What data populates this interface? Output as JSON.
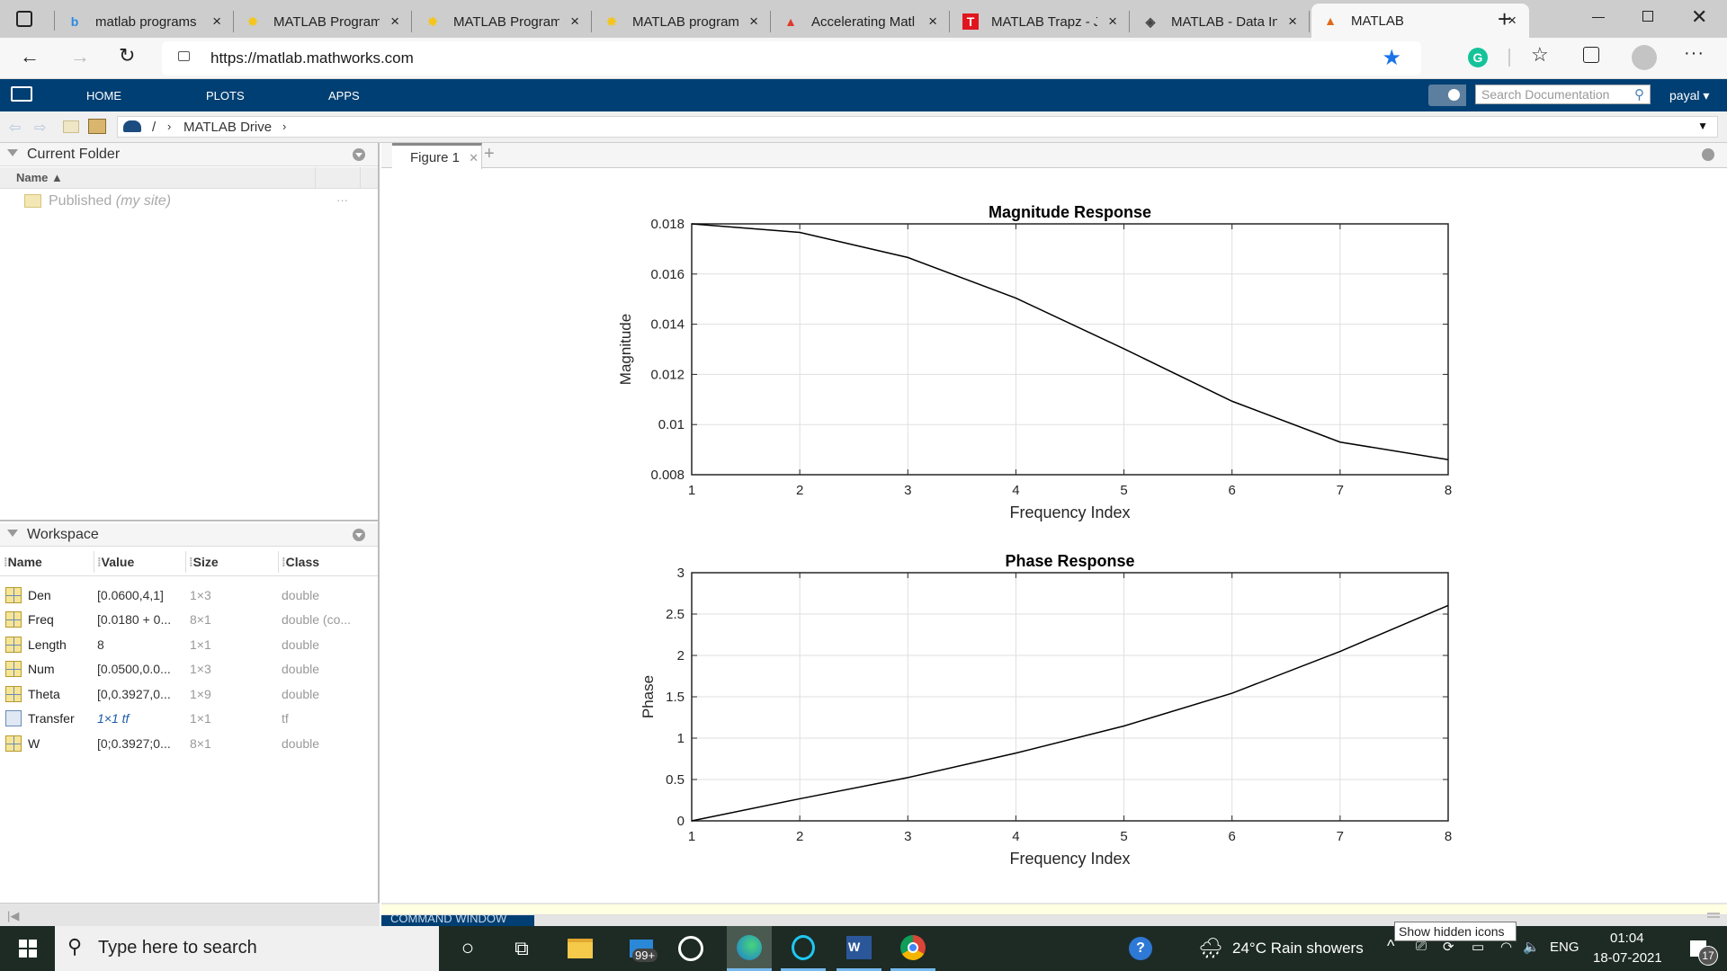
{
  "browser": {
    "tabs": [
      {
        "label": "matlab programs",
        "icon": "bing-icon",
        "active": false
      },
      {
        "label": "MATLAB Program",
        "icon": "matlab-star-icon",
        "active": false
      },
      {
        "label": "MATLAB Program",
        "icon": "matlab-star-icon",
        "active": false
      },
      {
        "label": "MATLAB program",
        "icon": "matlab-star-icon",
        "active": false
      },
      {
        "label": "Accelerating Matl",
        "icon": "mathworks-icon",
        "active": false
      },
      {
        "label": "MATLAB Trapz - J",
        "icon": "t-icon",
        "active": false
      },
      {
        "label": "MATLAB - Data In",
        "icon": "diamond-icon",
        "active": false
      },
      {
        "label": "MATLAB",
        "icon": "matlab-icon",
        "active": true
      }
    ],
    "url": "https://matlab.mathworks.com",
    "new_tab": "+",
    "close": "×"
  },
  "matlab": {
    "toolstrip_tabs": [
      "HOME",
      "PLOTS",
      "APPS"
    ],
    "search_placeholder": "Search Documentation",
    "user": "payal",
    "breadcrumb": [
      "/",
      "MATLAB Drive"
    ],
    "current_folder": {
      "title": "Current Folder",
      "column": "Name",
      "items": [
        {
          "name": "Published",
          "note": "(my site)",
          "more": "···"
        }
      ]
    },
    "workspace": {
      "title": "Workspace",
      "columns": [
        "Name",
        "Value",
        "Size",
        "Class"
      ],
      "rows": [
        {
          "name": "Den",
          "value": "[0.0600,4,1]",
          "size": "1×3",
          "class": "double",
          "type": "matrix"
        },
        {
          "name": "Freq",
          "value": "[0.0180 + 0...",
          "size": "8×1",
          "class": "double (co...",
          "type": "matrix"
        },
        {
          "name": "Length",
          "value": "8",
          "size": "1×1",
          "class": "double",
          "type": "matrix"
        },
        {
          "name": "Num",
          "value": "[0.0500,0.0...",
          "size": "1×3",
          "class": "double",
          "type": "matrix"
        },
        {
          "name": "Theta",
          "value": "[0,0.3927,0...",
          "size": "1×9",
          "class": "double",
          "type": "matrix"
        },
        {
          "name": "Transfer",
          "value": "1×1 tf",
          "size": "1×1",
          "class": "tf",
          "type": "object"
        },
        {
          "name": "W",
          "value": "[0;0.3927;0...",
          "size": "8×1",
          "class": "double",
          "type": "matrix"
        }
      ]
    },
    "figure_tab": "Figure 1",
    "figure_add": "+",
    "command_window_label": "COMMAND WINDOW"
  },
  "chart_data": [
    {
      "type": "line",
      "title": "Magnitude Response",
      "xlabel": "Frequency Index",
      "ylabel": "Magnitude",
      "x": [
        1,
        2,
        3,
        4,
        5,
        6,
        7,
        8
      ],
      "series": [
        {
          "name": "Magnitude",
          "values": [
            0.018,
            0.01766,
            0.01666,
            0.01504,
            0.01302,
            0.01093,
            0.0093,
            0.0086
          ]
        }
      ],
      "xlim": [
        1,
        8
      ],
      "ylim": [
        0.008,
        0.018
      ],
      "xticks": [
        "1",
        "2",
        "3",
        "4",
        "5",
        "6",
        "7",
        "8"
      ],
      "yticks": [
        "0.008",
        "0.01",
        "0.012",
        "0.014",
        "0.016",
        "0.018"
      ],
      "ytick_values": [
        0.008,
        0.01,
        0.012,
        0.014,
        0.016,
        0.018
      ],
      "grid": true
    },
    {
      "type": "line",
      "title": "Phase Response",
      "xlabel": "Frequency Index",
      "ylabel": "Phase",
      "x": [
        1,
        2,
        3,
        4,
        5,
        6,
        7,
        8
      ],
      "series": [
        {
          "name": "Phase",
          "values": [
            0,
            0.267,
            0.523,
            0.819,
            1.147,
            1.543,
            2.048,
            2.604
          ]
        }
      ],
      "xlim": [
        1,
        8
      ],
      "ylim": [
        0,
        3
      ],
      "xticks": [
        "1",
        "2",
        "3",
        "4",
        "5",
        "6",
        "7",
        "8"
      ],
      "yticks": [
        "0",
        "0.5",
        "1",
        "1.5",
        "2",
        "2.5",
        "3"
      ],
      "ytick_values": [
        0,
        0.5,
        1,
        1.5,
        2,
        2.5,
        3
      ],
      "grid": true
    }
  ],
  "taskbar": {
    "search_placeholder": "Type here to search",
    "mail_badge": "99+",
    "weather": "24°C  Rain showers",
    "language": "ENG",
    "time": "01:04",
    "date": "18-07-2021",
    "notifications": "17",
    "tooltip": "Show hidden icons"
  }
}
